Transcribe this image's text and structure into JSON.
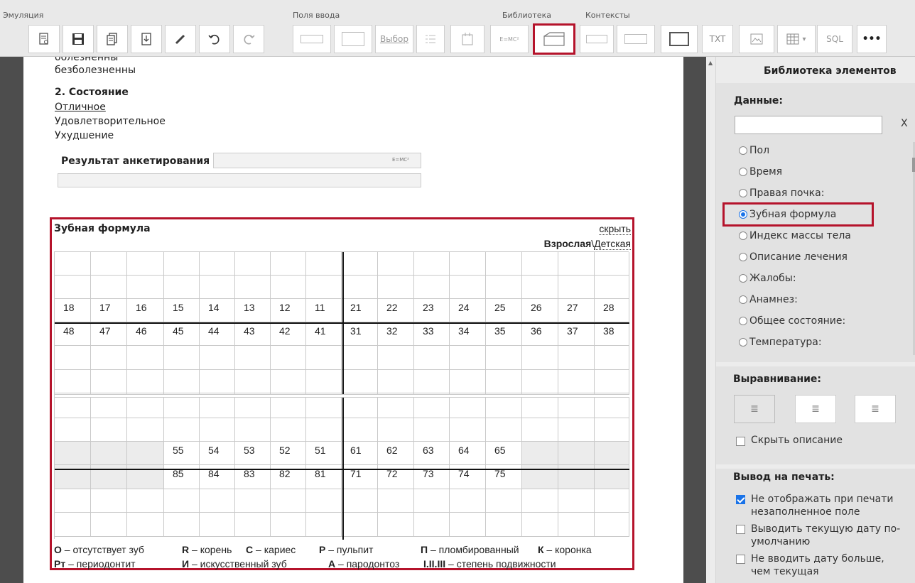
{
  "toolbar": {
    "groups": [
      "Эмуляция",
      "Поля ввода",
      "Библиотека",
      "Контексты"
    ],
    "buttons": {
      "select_label": "Выбор",
      "formula_label": "E=MC²",
      "txt_label": "TXT",
      "sql_label": "SQL",
      "more_label": "•••"
    }
  },
  "document": {
    "line_prev": "оолезненны",
    "line_painless": "безболезненны",
    "section_title": "2. Состояние",
    "options": [
      "Отличное",
      "Удовлетворительное",
      "Ухудшение"
    ],
    "survey_label": "Результат анкетирования",
    "survey_formula": "E=MC²"
  },
  "dental": {
    "title": "Зубная формула",
    "hide_link": "скрыть",
    "mode_adult": "Взрослая",
    "mode_sep": "\\",
    "mode_child": "Детская",
    "adult_upper": [
      "18",
      "17",
      "16",
      "15",
      "14",
      "13",
      "12",
      "11",
      "21",
      "22",
      "23",
      "24",
      "25",
      "26",
      "27",
      "28"
    ],
    "adult_lower": [
      "48",
      "47",
      "46",
      "45",
      "44",
      "43",
      "42",
      "41",
      "31",
      "32",
      "33",
      "34",
      "35",
      "36",
      "37",
      "38"
    ],
    "child_upper": [
      "",
      "",
      "",
      "55",
      "54",
      "53",
      "52",
      "51",
      "61",
      "62",
      "63",
      "64",
      "65",
      "",
      "",
      ""
    ],
    "child_lower": [
      "",
      "",
      "",
      "85",
      "84",
      "83",
      "82",
      "81",
      "71",
      "72",
      "73",
      "74",
      "75",
      "",
      "",
      ""
    ],
    "legend_row1": [
      {
        "key": "O",
        "text": " – отсутствует зуб"
      },
      {
        "key": "R",
        "text": " – корень"
      },
      {
        "key": "C",
        "text": " – кариес"
      },
      {
        "key": "P",
        "text": " – пульпит"
      },
      {
        "key": "П",
        "text": " – пломбированный"
      },
      {
        "key": "К",
        "text": " – коронка"
      }
    ],
    "legend_row2": [
      {
        "key": "Рт",
        "text": " – периодонтит"
      },
      {
        "key": "И",
        "text": " – искусственный зуб"
      },
      {
        "key": "А",
        "text": " – пародонтоз"
      },
      {
        "key": "I.II.III",
        "text": " – степень подвижности"
      }
    ]
  },
  "sidebar": {
    "title": "Библиотека элементов",
    "data_label": "Данные:",
    "search_value": "",
    "clear_label": "X",
    "items": [
      "Пол",
      "Время",
      "Правая почка:",
      "Зубная формула",
      "Индекс массы тела",
      "Описание лечения",
      "Жалобы:",
      "Анамнез:",
      "Общее состояние:",
      "Температура:"
    ],
    "selected_item": "Зубная формула",
    "align_label": "Выравнивание:",
    "hide_desc": "Скрыть описание",
    "print_label": "Вывод на печать:",
    "print_options": [
      {
        "label": "Не отображать при печати незаполненное поле",
        "checked": true
      },
      {
        "label": "Выводить текущую дату по-умолчанию",
        "checked": false
      },
      {
        "label": "Не вводить дату больше, чем текущая",
        "checked": false
      }
    ]
  },
  "colors": {
    "accent_red": "#b5132b",
    "radio_blue": "#1a73e8"
  }
}
